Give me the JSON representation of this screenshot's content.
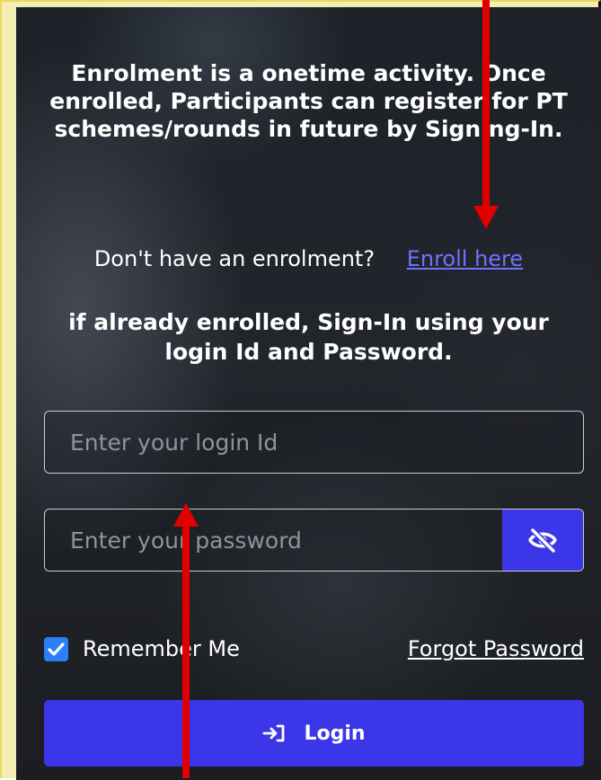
{
  "info": {
    "headline": "Enrolment is a onetime activity. Once enrolled, Participants can register for PT schemes/rounds in future by Signing-In.",
    "enroll_prompt": "Don't have an enrolment?",
    "enroll_link": "Enroll here",
    "signin_hint": "if already enrolled, Sign-In using your login Id and Password."
  },
  "form": {
    "login_id_placeholder": "Enter your login Id",
    "password_placeholder": "Enter your password",
    "remember_label": "Remember Me",
    "remember_checked": true,
    "forgot_label": "Forgot Password",
    "login_label": "Login"
  },
  "icons": {
    "password_toggle": "eye-slash-icon",
    "login": "sign-in-icon",
    "checkbox": "check-icon"
  },
  "colors": {
    "accent": "#3b37e8",
    "link": "#6f72ff",
    "checkbox": "#2d7ff9",
    "annotation_arrow": "#e00000"
  }
}
